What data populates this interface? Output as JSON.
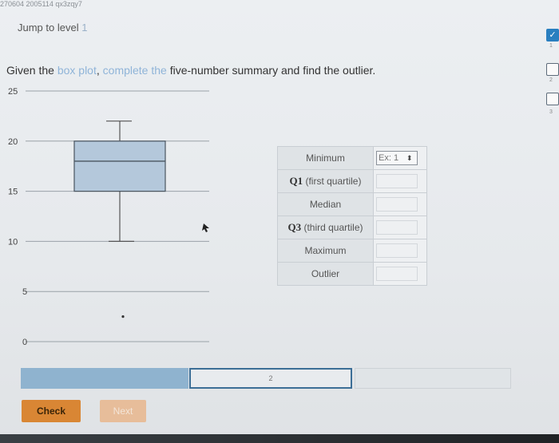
{
  "header": {
    "id_text": "270604 2005114 qx3zqy7",
    "jump_label": "Jump to level",
    "jump_level": "1"
  },
  "question": {
    "prefix": "Given the ",
    "link_text": "box plot",
    "mid": ", ",
    "link2": "complete the",
    "suffix": " five-number summary and find the outlier."
  },
  "levels": [
    {
      "num": "1",
      "done": true
    },
    {
      "num": "2",
      "done": false
    },
    {
      "num": "3",
      "done": false
    }
  ],
  "chart_data": {
    "type": "box",
    "yticks": [
      25,
      20,
      15,
      10,
      5,
      0
    ],
    "ylim": [
      0,
      25
    ],
    "minimum": 10,
    "q1": 15,
    "median": 18,
    "q3": 20,
    "maximum": 22,
    "outlier": 2.5,
    "grid": true
  },
  "summary": {
    "rows": [
      {
        "label": "Minimum",
        "value": "",
        "placeholder": "Ex: 1"
      },
      {
        "label_q": "Q1",
        "label": " (first quartile)",
        "value": "",
        "placeholder": ""
      },
      {
        "label": "Median",
        "value": "",
        "placeholder": ""
      },
      {
        "label_q": "Q3",
        "label": " (third quartile)",
        "value": "",
        "placeholder": ""
      },
      {
        "label": "Maximum",
        "value": "",
        "placeholder": ""
      },
      {
        "label": "Outlier",
        "value": "",
        "placeholder": ""
      }
    ]
  },
  "progress": {
    "seg1": "1",
    "seg2": "2",
    "seg3": ""
  },
  "buttons": {
    "check": "Check",
    "next": "Next"
  },
  "colors": {
    "accent": "#2a7fc0",
    "box_fill": "#b4c8db",
    "check": "#d98634"
  }
}
